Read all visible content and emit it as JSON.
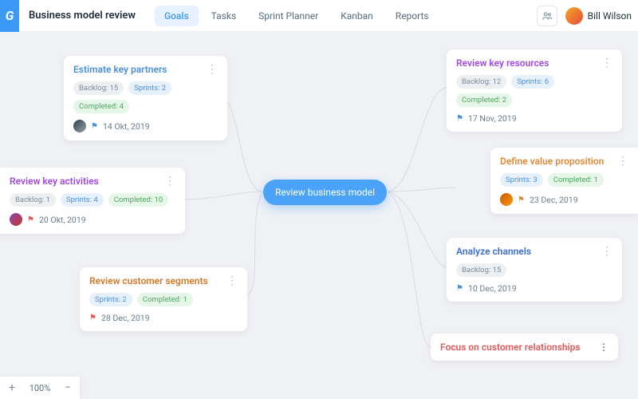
{
  "header": {
    "logo_letter": "G",
    "title": "Business model review",
    "tabs": [
      "Goals",
      "Tasks",
      "Sprint Planner",
      "Kanban",
      "Reports"
    ],
    "active_tab": 0,
    "user_name": "Bill Wilson"
  },
  "center": {
    "label": "Review business model"
  },
  "cards": {
    "estimate_partners": {
      "title": "Estimate key partners",
      "backlog": "Backlog: 15",
      "sprints": "Sprints: 2",
      "completed": "Completed: 4",
      "date": "14 Okt, 2019"
    },
    "key_activities": {
      "title": "Review key activities",
      "backlog": "Backlog: 1",
      "sprints": "Sprints: 4",
      "completed": "Completed: 10",
      "date": "20 Okt, 2019"
    },
    "customer_segments": {
      "title": "Review customer segments",
      "sprints": "Sprints: 2",
      "completed": "Completed: 1",
      "date": "28 Dec, 2019"
    },
    "key_resources": {
      "title": "Review key resources",
      "backlog": "Backlog: 12",
      "sprints": "Sprints: 6",
      "completed": "Completed: 2",
      "date": "17 Nov, 2019"
    },
    "value_prop": {
      "title": "Define value proposition",
      "sprints": "Sprints: 3",
      "completed": "Completed: 1",
      "date": "23 Dec, 2019"
    },
    "channels": {
      "title": "Analyze channels",
      "backlog": "Backlog: 15",
      "date": "10 Dec, 2019"
    },
    "relationships": {
      "title": "Focus on customer relationships"
    }
  },
  "zoom": {
    "level": "100%"
  }
}
